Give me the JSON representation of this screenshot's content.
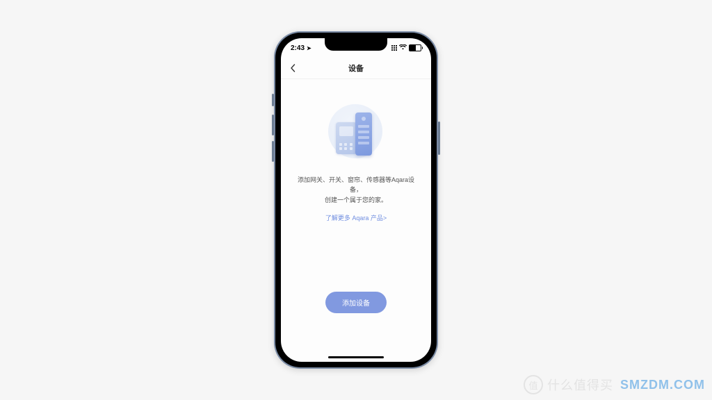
{
  "status_bar": {
    "time": "2:43",
    "location_icon": "location-arrow-icon",
    "signal_icon": "cellular-grid-icon",
    "wifi_icon": "wifi-icon",
    "battery_icon": "battery-icon"
  },
  "nav": {
    "back_icon": "chevron-left-icon",
    "title": "设备"
  },
  "empty_state": {
    "illustration": "smart-devices-illustration",
    "line1": "添加网关、开关、窗帘、传感器等Aqara设备，",
    "line2": "创建一个属于您的家。",
    "learn_more": "了解更多 Aqara 产品>"
  },
  "primary_action": {
    "label": "添加设备"
  },
  "watermark": {
    "badge": "值",
    "cn_text": "什么值得买",
    "en_text": "SMZDM.COM"
  },
  "colors": {
    "accent": "#8199e0",
    "link": "#6f8de0",
    "page_bg": "#f6f6f6",
    "screen_bg": "#fdfdfd"
  }
}
